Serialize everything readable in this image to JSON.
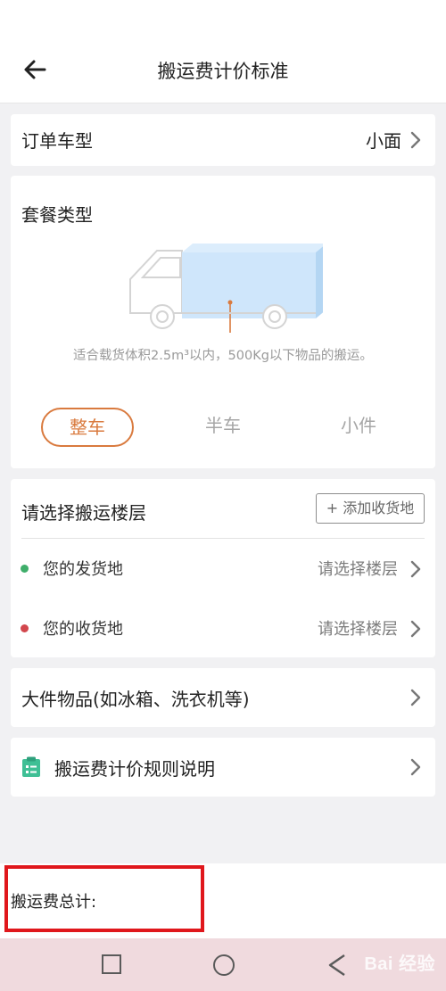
{
  "header": {
    "title": "搬运费计价标准"
  },
  "vehicle": {
    "label": "订单车型",
    "value": "小面"
  },
  "package": {
    "label": "套餐类型",
    "description": "适合载货体积2.5m³以内，500Kg以下物品的搬运。",
    "tabs": [
      {
        "label": "整车",
        "active": true
      },
      {
        "label": "半车",
        "active": false
      },
      {
        "label": "小件",
        "active": false
      }
    ]
  },
  "floors": {
    "title": "请选择搬运楼层",
    "add_button": "+ 添加收货地",
    "origin": {
      "label": "您的发货地",
      "value": "请选择楼层",
      "dot_color": "#3fae6a"
    },
    "destination": {
      "label": "您的收货地",
      "value": "请选择楼层",
      "dot_color": "#d2474d"
    }
  },
  "bulky": {
    "label": "大件物品(如冰箱、洗衣机等)"
  },
  "rules": {
    "label": "搬运费计价规则说明",
    "icon": "clipboard-icon"
  },
  "total": {
    "label": "搬运费总计:"
  },
  "watermark": {
    "text": "Bai 经验"
  },
  "colors": {
    "accent": "#d97a3e",
    "highlight": "#e0171c",
    "truck_cargo": "#cfe6fb"
  }
}
